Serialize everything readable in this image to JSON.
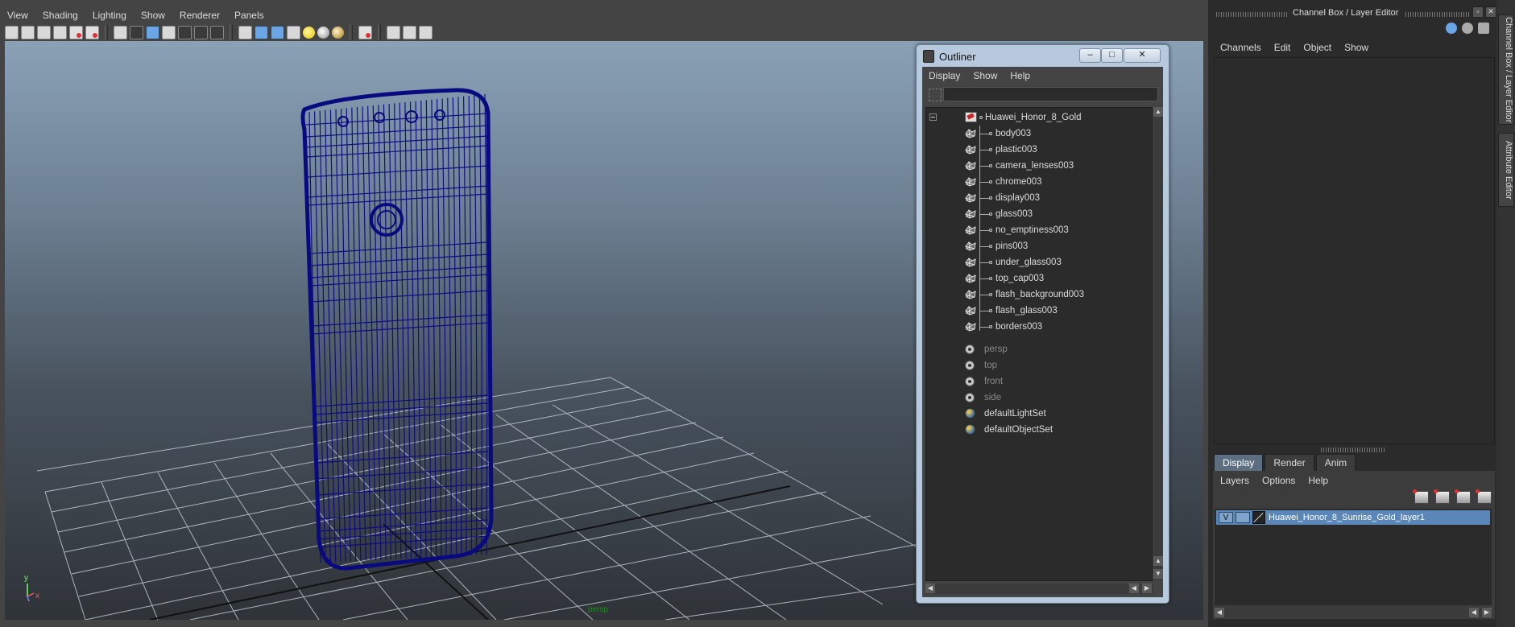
{
  "viewport": {
    "menus": [
      "View",
      "Shading",
      "Lighting",
      "Show",
      "Renderer",
      "Panels"
    ],
    "camera_label": "persp",
    "axis": {
      "x": "x",
      "y": "y"
    },
    "toolbar_icons": [
      "select-camera-icon",
      "camera-attributes-icon",
      "bookmark-icon",
      "image-plane-icon",
      "2d-pan-zoom-icon",
      "grease-pencil-icon",
      "grid-icon",
      "film-gate-icon",
      "resolution-gate-icon",
      "gate-mask-icon",
      "field-chart-icon",
      "safe-action-icon",
      "safe-title-icon",
      "wireframe-icon",
      "smooth-shade-icon",
      "default-material-icon",
      "textured-icon",
      "use-all-lights-icon",
      "shadows-icon",
      "screen-space-ao-icon",
      "isolate-select-icon",
      "xray-icon",
      "xray-joints-icon",
      "xray-components-icon"
    ]
  },
  "outliner": {
    "title": "Outliner",
    "menus": [
      "Display",
      "Show",
      "Help"
    ],
    "root": "Huawei_Honor_8_Gold",
    "children": [
      "body003",
      "plastic003",
      "camera_lenses003",
      "chrome003",
      "display003",
      "glass003",
      "no_emptiness003",
      "pins003",
      "under_glass003",
      "top_cap003",
      "flash_background003",
      "flash_glass003",
      "borders003"
    ],
    "cameras": [
      "persp",
      "top",
      "front",
      "side"
    ],
    "sets": [
      "defaultLightSet",
      "defaultObjectSet"
    ]
  },
  "dock": {
    "title": "Channel Box / Layer Editor",
    "channel_menus": [
      "Channels",
      "Edit",
      "Object",
      "Show"
    ],
    "layer_tabs": [
      "Display",
      "Render",
      "Anim"
    ],
    "active_tab": "Display",
    "layer_menus": [
      "Layers",
      "Options",
      "Help"
    ],
    "layer": {
      "visibility": "V",
      "name": "Huawei_Honor_8_Sunrise_Gold_layer1"
    },
    "side_tabs": [
      "Channel Box / Layer Editor",
      "Attribute Editor"
    ]
  },
  "colors": {
    "wireframe": "#0a0a80",
    "layer_highlight": "#5a87b8",
    "outliner_frame": "#b7c9dc"
  }
}
